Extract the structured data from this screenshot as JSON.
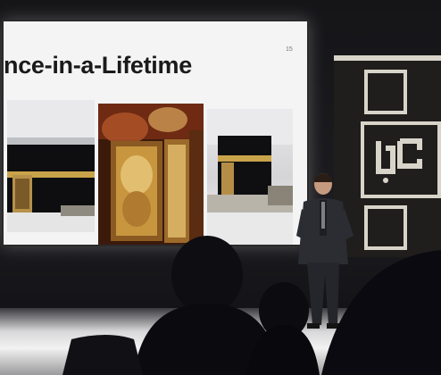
{
  "scene": {
    "setting": "conference stage"
  },
  "slide": {
    "title": "nce-in-a-Lifetime",
    "page_number": "15",
    "photos": [
      "photo-left",
      "photo-center",
      "photo-right"
    ]
  },
  "colors": {
    "screen_bg": "#f4f4f4",
    "title_text": "#1a1a1a",
    "logo_frame": "#d9d4c9",
    "stage_dark": "#151518"
  }
}
